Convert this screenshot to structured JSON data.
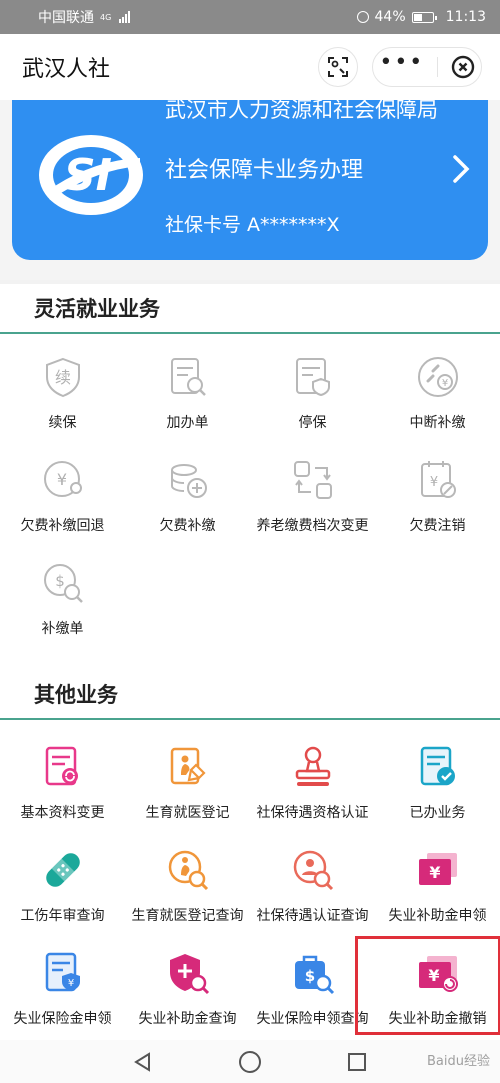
{
  "status_bar": {
    "carrier": "中国联通",
    "network": "4G",
    "battery": "44%",
    "time": "11:13"
  },
  "header": {
    "title": "武汉人社"
  },
  "banner": {
    "agency": "武汉市人力资源和社会保障局",
    "service": "社会保障卡业务办理",
    "card_number": "社保卡号 A*******X",
    "logo_text": "SI"
  },
  "sections": [
    {
      "title": "灵活就业业务",
      "items": [
        {
          "label": "续保",
          "icon": "renew-shield-icon"
        },
        {
          "label": "加办单",
          "icon": "document-search-icon"
        },
        {
          "label": "停保",
          "icon": "document-shield-icon"
        },
        {
          "label": "中断补缴",
          "icon": "broken-link-yuan-icon"
        },
        {
          "label": "欠费补缴回退",
          "icon": "yuan-refresh-icon"
        },
        {
          "label": "欠费补缴",
          "icon": "coins-add-icon"
        },
        {
          "label": "养老缴费档次变更",
          "icon": "swap-icon"
        },
        {
          "label": "欠费注销",
          "icon": "calendar-yuan-cancel-icon"
        },
        {
          "label": "补缴单",
          "icon": "dollar-coin-search-icon"
        }
      ]
    },
    {
      "title": "其他业务",
      "items": [
        {
          "label": "基本资料变更",
          "icon": "profile-refresh-icon"
        },
        {
          "label": "生育就医登记",
          "icon": "maternity-edit-icon"
        },
        {
          "label": "社保待遇资格认证",
          "icon": "seal-stamp-icon"
        },
        {
          "label": "已办业务",
          "icon": "document-check-icon"
        },
        {
          "label": "工伤年审查询",
          "icon": "bandage-icon"
        },
        {
          "label": "生育就医登记查询",
          "icon": "maternity-search-icon"
        },
        {
          "label": "社保待遇认证查询",
          "icon": "user-search-icon"
        },
        {
          "label": "失业补助金申领",
          "icon": "yuan-cards-icon"
        },
        {
          "label": "失业保险金申领",
          "icon": "document-yuan-shield-icon"
        },
        {
          "label": "失业补助金查询",
          "icon": "shield-add-search-icon"
        },
        {
          "label": "失业保险申领查询",
          "icon": "bag-dollar-search-icon"
        },
        {
          "label": "失业补助金撤销",
          "icon": "yuan-cards-undo-icon"
        }
      ]
    }
  ],
  "watermark": "Baidu经验",
  "colors": {
    "banner": "#2f8ff1",
    "section_divider": "#4aa38e",
    "highlight": "#e0303a",
    "pink": "#e8388a",
    "orange": "#f0963a",
    "teal": "#1ba89a",
    "blue": "#3a86e6",
    "red": "#e24b4b"
  }
}
